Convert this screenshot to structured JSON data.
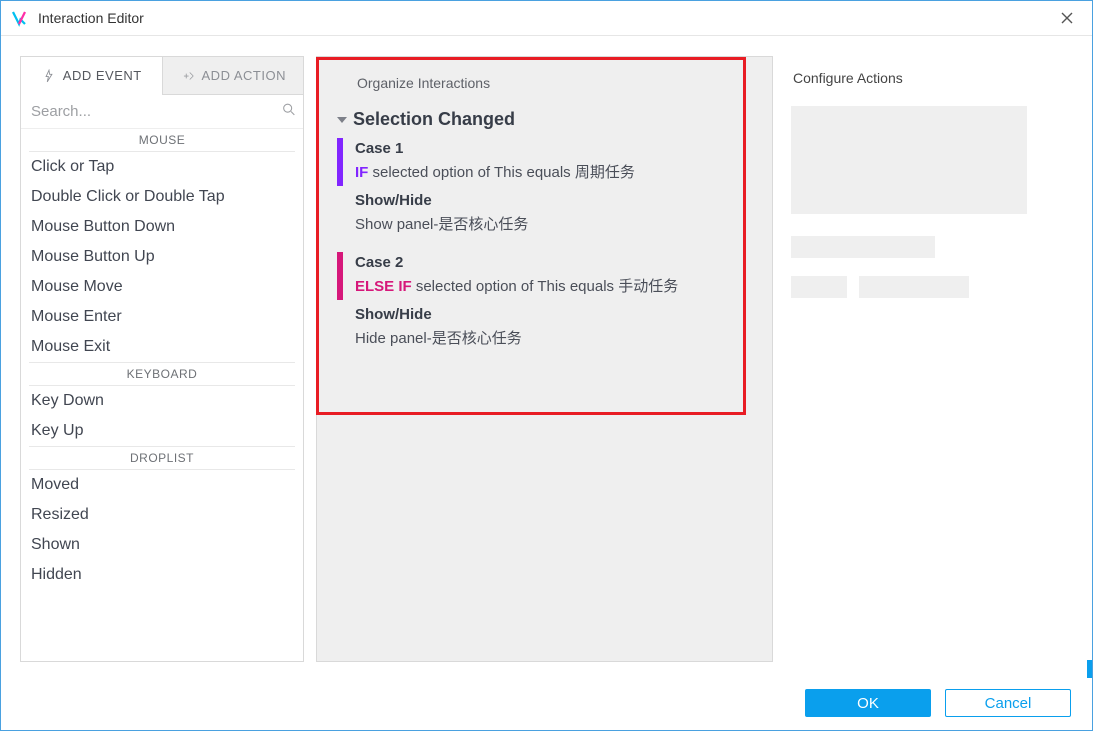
{
  "window": {
    "title": "Interaction Editor"
  },
  "tabs": {
    "add_event": "ADD EVENT",
    "add_action": "ADD ACTION"
  },
  "search": {
    "placeholder": "Search..."
  },
  "event_groups": [
    {
      "header": "MOUSE",
      "items": [
        "Click or Tap",
        "Double Click or Double Tap",
        "Mouse Button Down",
        "Mouse Button Up",
        "Mouse Move",
        "Mouse Enter",
        "Mouse Exit"
      ]
    },
    {
      "header": "KEYBOARD",
      "items": [
        "Key Down",
        "Key Up"
      ]
    },
    {
      "header": "DROPLIST",
      "items": [
        "Moved",
        "Resized",
        "Shown",
        "Hidden"
      ]
    }
  ],
  "center": {
    "heading": "Organize Interactions",
    "event_name": "Selection Changed",
    "cases": [
      {
        "bar_color": "purple",
        "case_label": "Case 1",
        "cond_kw": "IF",
        "cond_kw_class": "kw-if",
        "cond_text": "selected option of This equals 周期任务",
        "action_title": "Show/Hide",
        "action_detail": "Show panel-是否核心任务"
      },
      {
        "bar_color": "magenta",
        "case_label": "Case 2",
        "cond_kw": "ELSE IF",
        "cond_kw_class": "kw-elseif",
        "cond_text": "selected option of This equals 手动任务",
        "action_title": "Show/Hide",
        "action_detail": "Hide panel-是否核心任务"
      }
    ]
  },
  "right": {
    "heading": "Configure Actions"
  },
  "footer": {
    "ok": "OK",
    "cancel": "Cancel"
  }
}
